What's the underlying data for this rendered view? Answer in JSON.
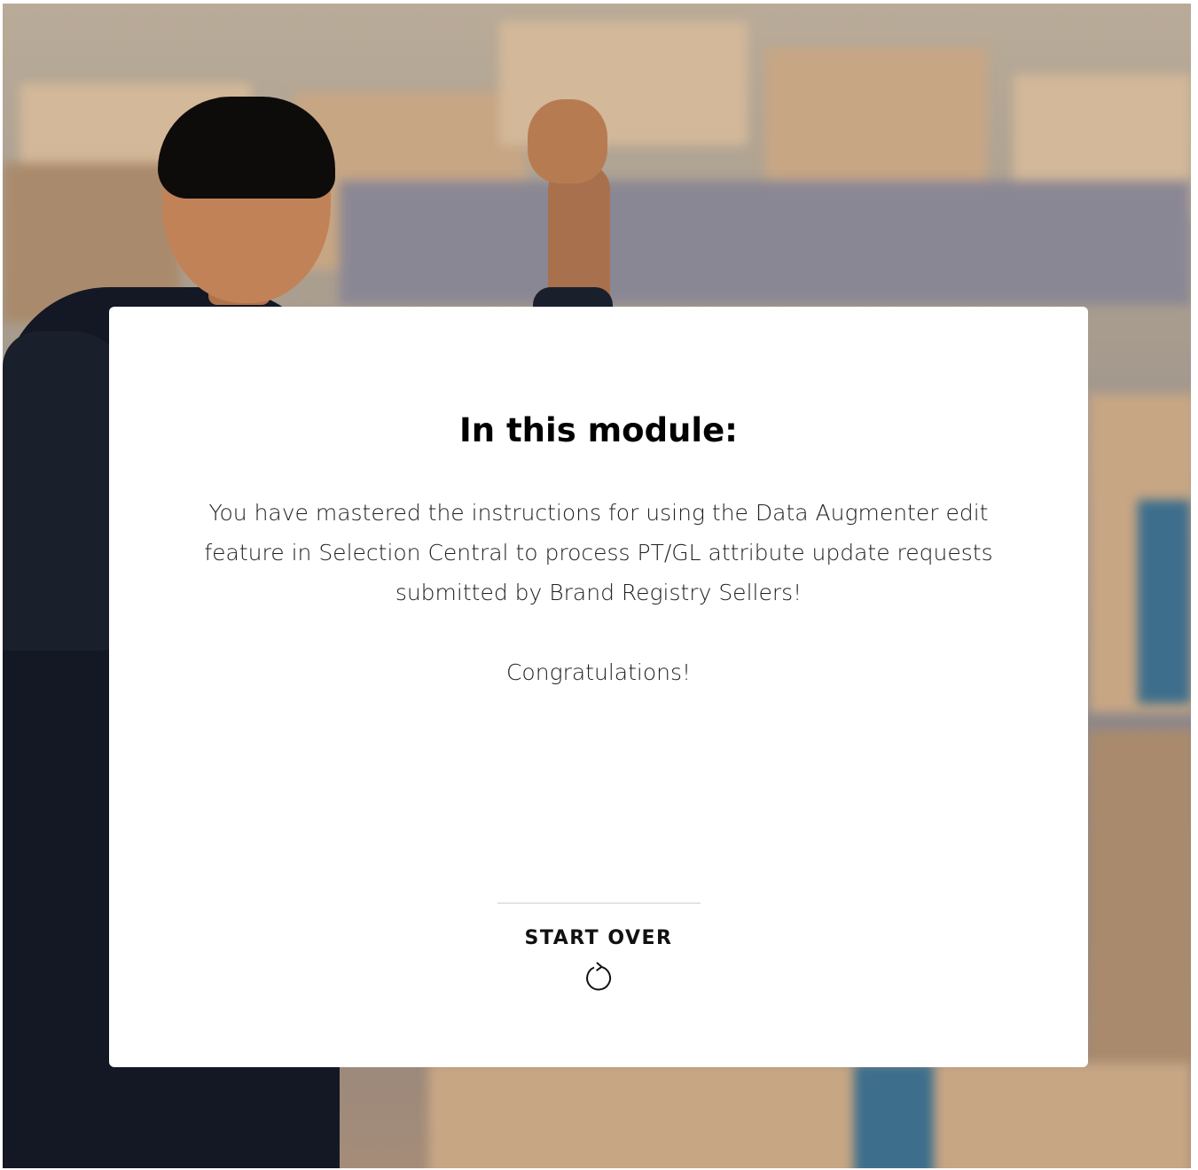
{
  "lesson": {
    "title": "In this module:",
    "summary": "You have mastered the instructions for using the Data Augmenter edit feature in Selection Central to process PT/GL attribute update requests submitted by Brand Registry Sellers!",
    "congrats": "Congratulations!"
  },
  "actions": {
    "start_over_label": "START OVER",
    "start_over_icon": "restart-icon"
  },
  "colors": {
    "card_background": "#ffffff",
    "title_text": "#000000",
    "body_text": "#1f1f1f",
    "divider": "#e4e4e4"
  }
}
